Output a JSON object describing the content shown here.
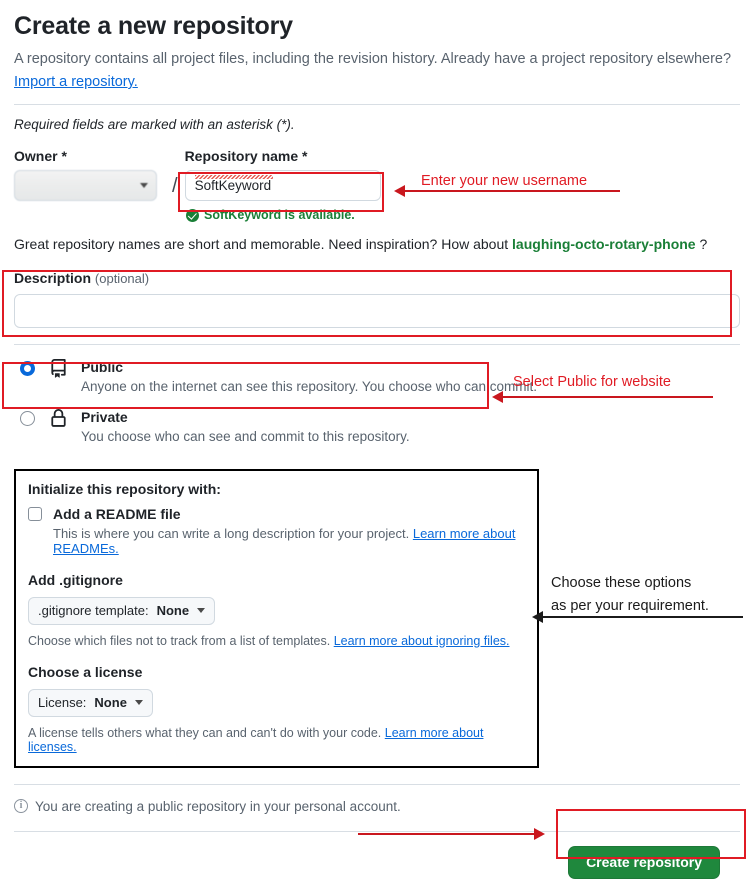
{
  "header": {
    "title": "Create a new repository",
    "subtitle": "A repository contains all project files, including the revision history. Already have a project repository elsewhere?",
    "import_link": "Import a repository.",
    "required_note": "Required fields are marked with an asterisk (*)."
  },
  "owner": {
    "label": "Owner *",
    "value": "",
    "separator": "/"
  },
  "repository": {
    "label": "Repository name *",
    "value": "SoftKeyword",
    "placeholder": "",
    "availability": "SoftKeyword is available."
  },
  "inspiration": {
    "prefix": "Great repository names are short and memorable. Need inspiration? How about",
    "suggestion": "laughing-octo-rotary-phone",
    "suffix": "?"
  },
  "description": {
    "label": "Description",
    "optional": "(optional)",
    "value": "",
    "placeholder": ""
  },
  "visibility": {
    "options": [
      {
        "id": "public",
        "title": "Public",
        "description": "Anyone on the internet can see this repository. You choose who can commit.",
        "selected": true,
        "icon": "repo-book-icon"
      },
      {
        "id": "private",
        "title": "Private",
        "description": "You choose who can see and commit to this repository.",
        "selected": false,
        "icon": "lock-icon"
      }
    ]
  },
  "initialize": {
    "heading": "Initialize this repository with:",
    "readme": {
      "label": "Add a README file",
      "checked": false,
      "help_text": "This is where you can write a long description for your project.",
      "help_link": "Learn more about READMEs."
    },
    "gitignore": {
      "heading": "Add .gitignore",
      "dropdown_prefix": ".gitignore template:",
      "dropdown_value": "None",
      "help_text": "Choose which files not to track from a list of templates.",
      "help_link": "Learn more about ignoring files."
    },
    "license": {
      "heading": "Choose a license",
      "dropdown_prefix": "License:",
      "dropdown_value": "None",
      "help_text": "A license tells others what they can and can't do with your code.",
      "help_link": "Learn more about licenses."
    }
  },
  "footer": {
    "notice": "You are creating a public repository in your personal account.",
    "info_glyph": "i",
    "create_button": "Create repository"
  },
  "annotations": [
    {
      "id": "username",
      "text": "Enter your new username",
      "color": "#e01b24"
    },
    {
      "id": "public",
      "text": "Select Public for website",
      "color": "#e01b24"
    },
    {
      "id": "options-line1",
      "text": "Choose these options",
      "color": "#1b1b1b"
    },
    {
      "id": "options-line2",
      "text": "as per your requirement.",
      "color": "#1b1b1b"
    }
  ],
  "colors": {
    "accent_green": "#1f883d",
    "link_blue": "#0969da",
    "annotation_red": "#e01b24",
    "radio_blue": "#0969da",
    "available_green": "#1a7f37"
  }
}
